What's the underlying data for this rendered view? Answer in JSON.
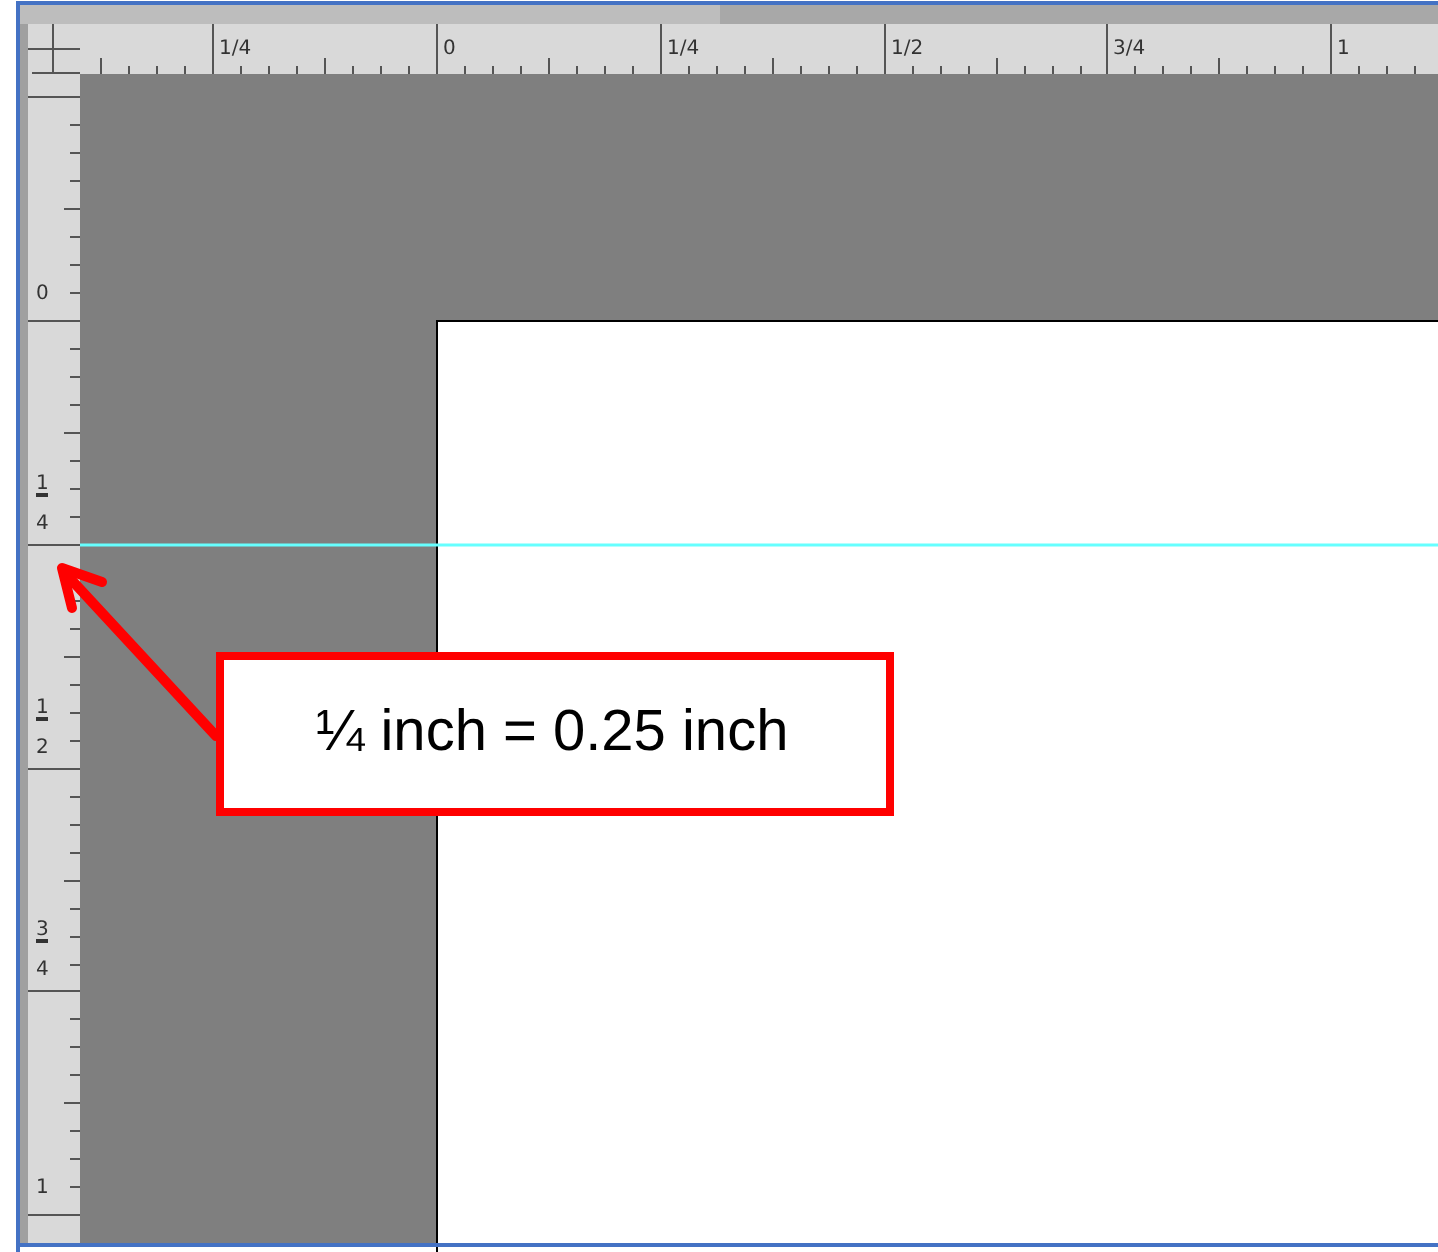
{
  "horizontal_ruler": {
    "labels": [
      "1/4",
      "0",
      "1/4",
      "1/2",
      "3/4",
      "1"
    ]
  },
  "vertical_ruler": {
    "labels": [
      {
        "numerator": "0"
      },
      {
        "numerator": "1",
        "denominator": "4"
      },
      {
        "numerator": "1",
        "denominator": "2"
      },
      {
        "numerator": "3",
        "denominator": "4"
      },
      {
        "numerator": "1"
      }
    ]
  },
  "callout": {
    "text": "¼ inch = 0.25 inch"
  }
}
